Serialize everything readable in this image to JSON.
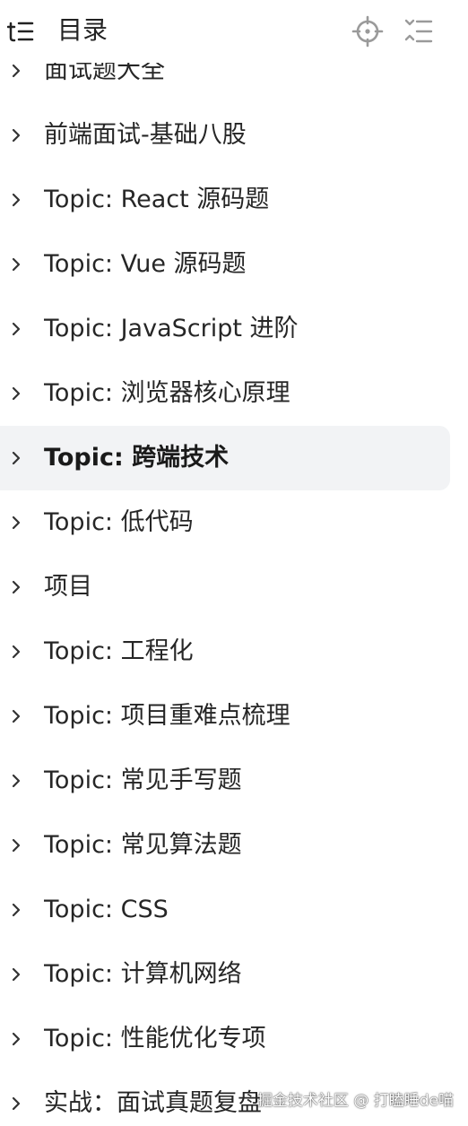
{
  "header": {
    "title": "目录",
    "toc_icon": "table-of-contents-icon",
    "locate_icon": "crosshair-icon",
    "collapse_icon": "collapse-list-icon"
  },
  "colors": {
    "text": "#262626",
    "icon": "#9a9a9a",
    "active_bg": "#f2f3f5"
  },
  "toc": {
    "items": [
      {
        "label": "面试题大全",
        "active": false
      },
      {
        "label": "前端面试-基础八股",
        "active": false
      },
      {
        "label": "Topic: React 源码题",
        "active": false
      },
      {
        "label": "Topic: Vue 源码题",
        "active": false
      },
      {
        "label": "Topic: JavaScript 进阶",
        "active": false
      },
      {
        "label": "Topic: 浏览器核心原理",
        "active": false
      },
      {
        "label": "Topic: 跨端技术",
        "active": true
      },
      {
        "label": "Topic: 低代码",
        "active": false
      },
      {
        "label": "项目",
        "active": false
      },
      {
        "label": "Topic: 工程化",
        "active": false
      },
      {
        "label": "Topic: 项目重难点梳理",
        "active": false
      },
      {
        "label": "Topic: 常见手写题",
        "active": false
      },
      {
        "label": "Topic: 常见算法题",
        "active": false
      },
      {
        "label": "Topic: CSS",
        "active": false
      },
      {
        "label": "Topic: 计算机网络",
        "active": false
      },
      {
        "label": "Topic: 性能优化专项",
        "active": false
      },
      {
        "label": "实战：面试真题复盘",
        "active": false
      }
    ]
  },
  "watermark": "掘金技术社区 @ 打瞌睡de喵"
}
